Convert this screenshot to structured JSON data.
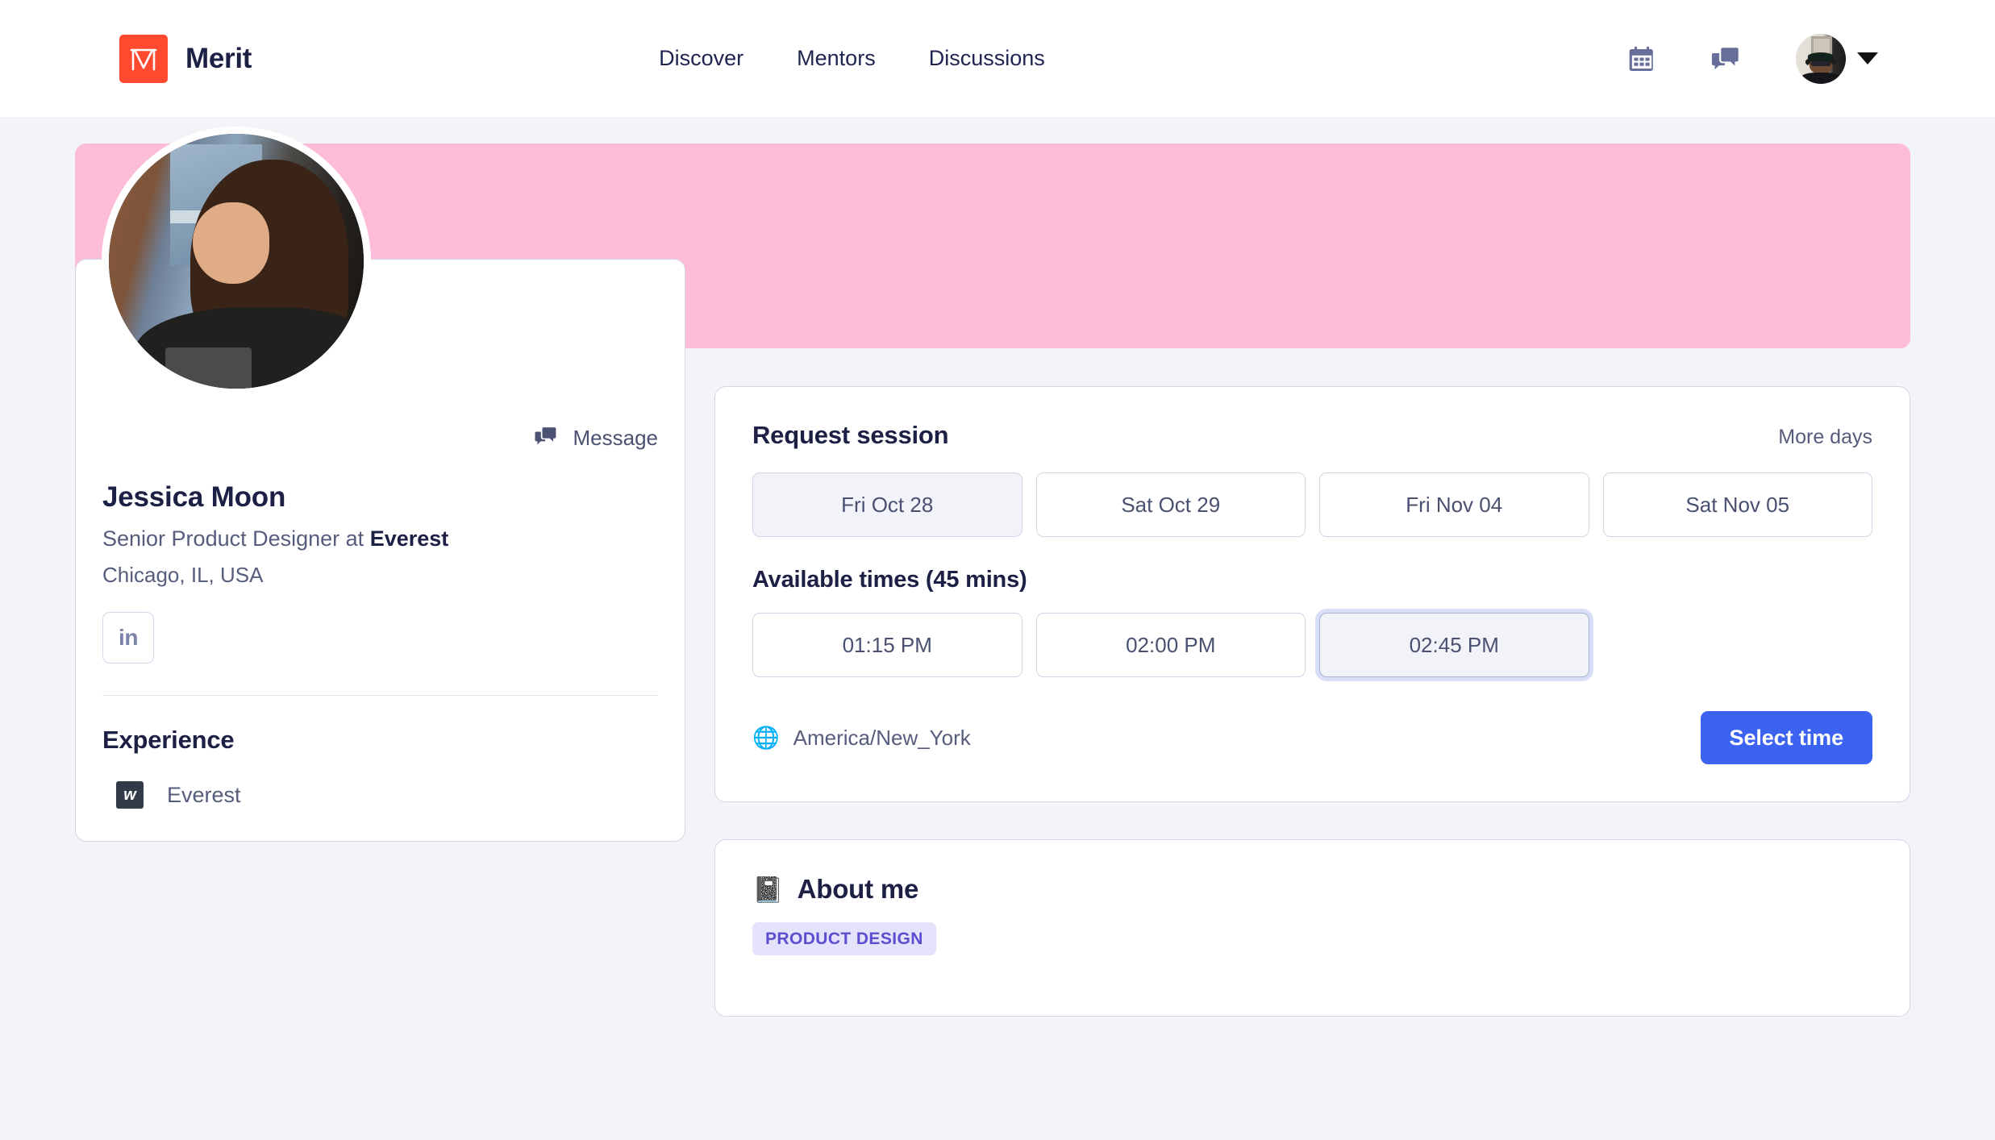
{
  "header": {
    "brand_name": "Merit",
    "brand_mark_letter": "M",
    "nav": [
      {
        "label": "Discover"
      },
      {
        "label": "Mentors"
      },
      {
        "label": "Discussions"
      }
    ],
    "calendar_icon": "calendar-icon",
    "messages_icon": "chat-bubbles-icon",
    "account_caret": "chevron-down-icon"
  },
  "profile": {
    "banner_color": "#fdbcd8",
    "message_label": "Message",
    "name": "Jessica Moon",
    "role_prefix": "Senior Product Designer at ",
    "role_company": "Everest",
    "location": "Chicago, IL, USA",
    "linkedin_label": "in",
    "experience_title": "Experience",
    "experience": [
      {
        "logo_letter": "w",
        "company": "Everest"
      }
    ]
  },
  "session": {
    "title": "Request session",
    "more_days_label": "More days",
    "days": [
      {
        "label": "Fri Oct 28",
        "state": "active"
      },
      {
        "label": "Sat Oct 29",
        "state": "default"
      },
      {
        "label": "Fri Nov 04",
        "state": "default"
      },
      {
        "label": "Sat Nov 05",
        "state": "default"
      }
    ],
    "times_title": "Available times (45 mins)",
    "times": [
      {
        "label": "01:15 PM",
        "state": "default"
      },
      {
        "label": "02:00 PM",
        "state": "default"
      },
      {
        "label": "02:45 PM",
        "state": "selected"
      }
    ],
    "timezone": "America/New_York",
    "timezone_icon": "globe-icon",
    "select_time_label": "Select time",
    "primary_color": "#3b63f0"
  },
  "about": {
    "emoji": "📓",
    "title": "About me",
    "tags": [
      {
        "label": "PRODUCT DESIGN"
      }
    ]
  }
}
